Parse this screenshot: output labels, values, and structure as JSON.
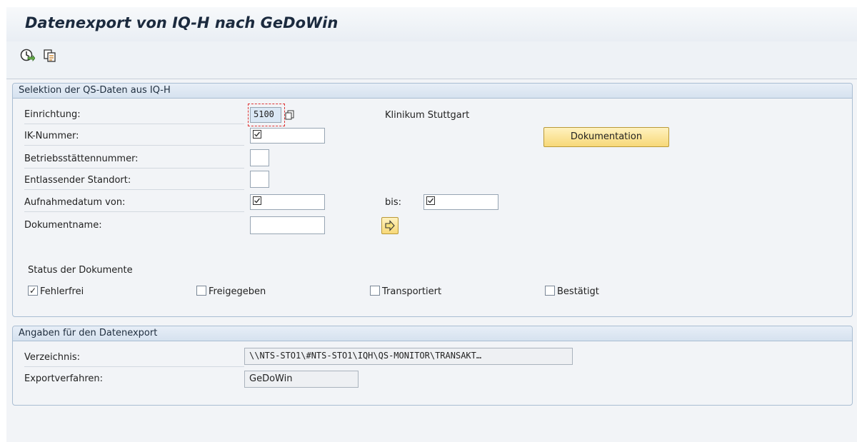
{
  "title": "Datenexport von IQ-H nach GeDoWin",
  "toolbar": {
    "execute_icon": "execute-clock-icon",
    "copy_icon": "copy-variant-icon"
  },
  "selection": {
    "header": "Selektion der QS-Daten aus IQ-H",
    "einrichtung": {
      "label": "Einrichtung:",
      "value": "5100",
      "description": "Klinikum Stuttgart"
    },
    "ik_nummer": {
      "label": "IK-Nummer:"
    },
    "betriebsstaette": {
      "label": "Betriebsstättennummer:"
    },
    "standort": {
      "label": "Entlassender Standort:"
    },
    "aufnahmedatum": {
      "label": "Aufnahmedatum von:",
      "bis_label": "bis:"
    },
    "dokumentname": {
      "label": "Dokumentname:"
    },
    "doc_button": "Dokumentation",
    "status_title": "Status der Dokumente",
    "status": [
      {
        "label": "Fehlerfrei",
        "checked": true
      },
      {
        "label": "Freigegeben",
        "checked": false
      },
      {
        "label": "Transportiert",
        "checked": false
      },
      {
        "label": "Bestätigt",
        "checked": false
      }
    ]
  },
  "export": {
    "header": "Angaben für den Datenexport",
    "verzeichnis": {
      "label": "Verzeichnis:",
      "value": "\\\\NTS-STO1\\#NTS-STO1\\IQH\\QS-MONITOR\\TRANSAKT…"
    },
    "verfahren": {
      "label": "Exportverfahren:",
      "value": "GeDoWin"
    }
  },
  "colors": {
    "accent_button": "#f7d878",
    "group_border": "#a9bdd2",
    "background": "#f2f4f7"
  }
}
